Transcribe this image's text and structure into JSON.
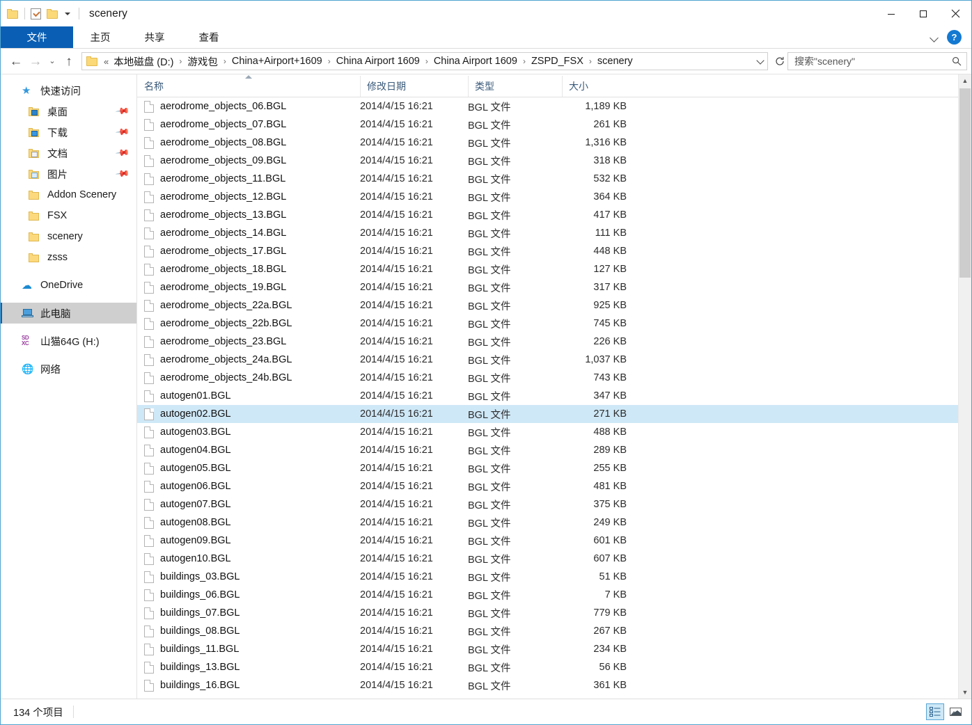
{
  "window": {
    "title": "scenery",
    "quick_access": [
      {
        "name": "folder-icon",
        "label": "folder"
      },
      {
        "name": "properties-icon",
        "label": "properties"
      },
      {
        "name": "new-folder-icon",
        "label": "new folder"
      },
      {
        "name": "customize-chevron-icon",
        "label": "customize"
      }
    ],
    "controls": {
      "minimize": "minimize",
      "maximize": "maximize",
      "close": "close"
    }
  },
  "ribbon": {
    "tabs": [
      {
        "label": "文件",
        "active": true
      },
      {
        "label": "主页",
        "active": false
      },
      {
        "label": "共享",
        "active": false
      },
      {
        "label": "查看",
        "active": false
      }
    ],
    "expand_label": "展开功能区",
    "help_label": "?"
  },
  "address": {
    "back_label": "后退",
    "forward_label": "前进",
    "recent_label": "最近浏览的位置",
    "up_label": "上移一级",
    "root_sep": "«",
    "crumbs": [
      "本地磁盘 (D:)",
      "游戏包",
      "China+Airport+1609",
      "China Airport 1609",
      "China Airport 1609",
      "ZSPD_FSX",
      "scenery"
    ],
    "separator": "›",
    "dropdown_label": "以前的位置",
    "refresh_label": "刷新"
  },
  "search": {
    "placeholder": "搜索\"scenery\"",
    "icon": "search-icon"
  },
  "sidebar": {
    "groups": [
      {
        "label": "快速访问",
        "icon": "star-icon",
        "selected": false,
        "items": [
          {
            "label": "桌面",
            "icon": "folder-desktop-icon",
            "pinned": true
          },
          {
            "label": "下载",
            "icon": "folder-downloads-icon",
            "pinned": true
          },
          {
            "label": "文档",
            "icon": "folder-documents-icon",
            "pinned": true
          },
          {
            "label": "图片",
            "icon": "folder-pictures-icon",
            "pinned": true
          },
          {
            "label": "Addon Scenery",
            "icon": "folder-icon",
            "pinned": false
          },
          {
            "label": "FSX",
            "icon": "folder-icon",
            "pinned": false
          },
          {
            "label": "scenery",
            "icon": "folder-icon",
            "pinned": false
          },
          {
            "label": "zsss",
            "icon": "folder-icon",
            "pinned": false
          }
        ]
      },
      {
        "label": "OneDrive",
        "icon": "cloud-icon",
        "selected": false,
        "items": []
      },
      {
        "label": "此电脑",
        "icon": "computer-icon",
        "selected": true,
        "items": []
      },
      {
        "label": "山猫64G (H:)",
        "icon": "sd-card-icon",
        "selected": false,
        "items": []
      },
      {
        "label": "网络",
        "icon": "network-icon",
        "selected": false,
        "items": []
      }
    ]
  },
  "filelist": {
    "columns": [
      {
        "label": "名称",
        "sorted": true
      },
      {
        "label": "修改日期",
        "sorted": false
      },
      {
        "label": "类型",
        "sorted": false
      },
      {
        "label": "大小",
        "sorted": false
      }
    ],
    "rows": [
      {
        "name": "aerodrome_objects_06.BGL",
        "date": "2014/4/15 16:21",
        "type": "BGL 文件",
        "size": "1,189 KB",
        "selected": false
      },
      {
        "name": "aerodrome_objects_07.BGL",
        "date": "2014/4/15 16:21",
        "type": "BGL 文件",
        "size": "261 KB",
        "selected": false
      },
      {
        "name": "aerodrome_objects_08.BGL",
        "date": "2014/4/15 16:21",
        "type": "BGL 文件",
        "size": "1,316 KB",
        "selected": false
      },
      {
        "name": "aerodrome_objects_09.BGL",
        "date": "2014/4/15 16:21",
        "type": "BGL 文件",
        "size": "318 KB",
        "selected": false
      },
      {
        "name": "aerodrome_objects_11.BGL",
        "date": "2014/4/15 16:21",
        "type": "BGL 文件",
        "size": "532 KB",
        "selected": false
      },
      {
        "name": "aerodrome_objects_12.BGL",
        "date": "2014/4/15 16:21",
        "type": "BGL 文件",
        "size": "364 KB",
        "selected": false
      },
      {
        "name": "aerodrome_objects_13.BGL",
        "date": "2014/4/15 16:21",
        "type": "BGL 文件",
        "size": "417 KB",
        "selected": false
      },
      {
        "name": "aerodrome_objects_14.BGL",
        "date": "2014/4/15 16:21",
        "type": "BGL 文件",
        "size": "111 KB",
        "selected": false
      },
      {
        "name": "aerodrome_objects_17.BGL",
        "date": "2014/4/15 16:21",
        "type": "BGL 文件",
        "size": "448 KB",
        "selected": false
      },
      {
        "name": "aerodrome_objects_18.BGL",
        "date": "2014/4/15 16:21",
        "type": "BGL 文件",
        "size": "127 KB",
        "selected": false
      },
      {
        "name": "aerodrome_objects_19.BGL",
        "date": "2014/4/15 16:21",
        "type": "BGL 文件",
        "size": "317 KB",
        "selected": false
      },
      {
        "name": "aerodrome_objects_22a.BGL",
        "date": "2014/4/15 16:21",
        "type": "BGL 文件",
        "size": "925 KB",
        "selected": false
      },
      {
        "name": "aerodrome_objects_22b.BGL",
        "date": "2014/4/15 16:21",
        "type": "BGL 文件",
        "size": "745 KB",
        "selected": false
      },
      {
        "name": "aerodrome_objects_23.BGL",
        "date": "2014/4/15 16:21",
        "type": "BGL 文件",
        "size": "226 KB",
        "selected": false
      },
      {
        "name": "aerodrome_objects_24a.BGL",
        "date": "2014/4/15 16:21",
        "type": "BGL 文件",
        "size": "1,037 KB",
        "selected": false
      },
      {
        "name": "aerodrome_objects_24b.BGL",
        "date": "2014/4/15 16:21",
        "type": "BGL 文件",
        "size": "743 KB",
        "selected": false
      },
      {
        "name": "autogen01.BGL",
        "date": "2014/4/15 16:21",
        "type": "BGL 文件",
        "size": "347 KB",
        "selected": false
      },
      {
        "name": "autogen02.BGL",
        "date": "2014/4/15 16:21",
        "type": "BGL 文件",
        "size": "271 KB",
        "selected": true
      },
      {
        "name": "autogen03.BGL",
        "date": "2014/4/15 16:21",
        "type": "BGL 文件",
        "size": "488 KB",
        "selected": false
      },
      {
        "name": "autogen04.BGL",
        "date": "2014/4/15 16:21",
        "type": "BGL 文件",
        "size": "289 KB",
        "selected": false
      },
      {
        "name": "autogen05.BGL",
        "date": "2014/4/15 16:21",
        "type": "BGL 文件",
        "size": "255 KB",
        "selected": false
      },
      {
        "name": "autogen06.BGL",
        "date": "2014/4/15 16:21",
        "type": "BGL 文件",
        "size": "481 KB",
        "selected": false
      },
      {
        "name": "autogen07.BGL",
        "date": "2014/4/15 16:21",
        "type": "BGL 文件",
        "size": "375 KB",
        "selected": false
      },
      {
        "name": "autogen08.BGL",
        "date": "2014/4/15 16:21",
        "type": "BGL 文件",
        "size": "249 KB",
        "selected": false
      },
      {
        "name": "autogen09.BGL",
        "date": "2014/4/15 16:21",
        "type": "BGL 文件",
        "size": "601 KB",
        "selected": false
      },
      {
        "name": "autogen10.BGL",
        "date": "2014/4/15 16:21",
        "type": "BGL 文件",
        "size": "607 KB",
        "selected": false
      },
      {
        "name": "buildings_03.BGL",
        "date": "2014/4/15 16:21",
        "type": "BGL 文件",
        "size": "51 KB",
        "selected": false
      },
      {
        "name": "buildings_06.BGL",
        "date": "2014/4/15 16:21",
        "type": "BGL 文件",
        "size": "7 KB",
        "selected": false
      },
      {
        "name": "buildings_07.BGL",
        "date": "2014/4/15 16:21",
        "type": "BGL 文件",
        "size": "779 KB",
        "selected": false
      },
      {
        "name": "buildings_08.BGL",
        "date": "2014/4/15 16:21",
        "type": "BGL 文件",
        "size": "267 KB",
        "selected": false
      },
      {
        "name": "buildings_11.BGL",
        "date": "2014/4/15 16:21",
        "type": "BGL 文件",
        "size": "234 KB",
        "selected": false
      },
      {
        "name": "buildings_13.BGL",
        "date": "2014/4/15 16:21",
        "type": "BGL 文件",
        "size": "56 KB",
        "selected": false
      },
      {
        "name": "buildings_16.BGL",
        "date": "2014/4/15 16:21",
        "type": "BGL 文件",
        "size": "361 KB",
        "selected": false
      }
    ]
  },
  "statusbar": {
    "item_count": "134 个项目",
    "views": [
      {
        "name": "details-view-button",
        "active": true
      },
      {
        "name": "large-icons-view-button",
        "active": false
      }
    ]
  },
  "colors": {
    "accent": "#0a5fb4",
    "selection": "#cfe8f7",
    "nav_selection": "#cfcfcf",
    "window_border": "#4fa3d1",
    "folder_yellow": "#fcd97c"
  }
}
